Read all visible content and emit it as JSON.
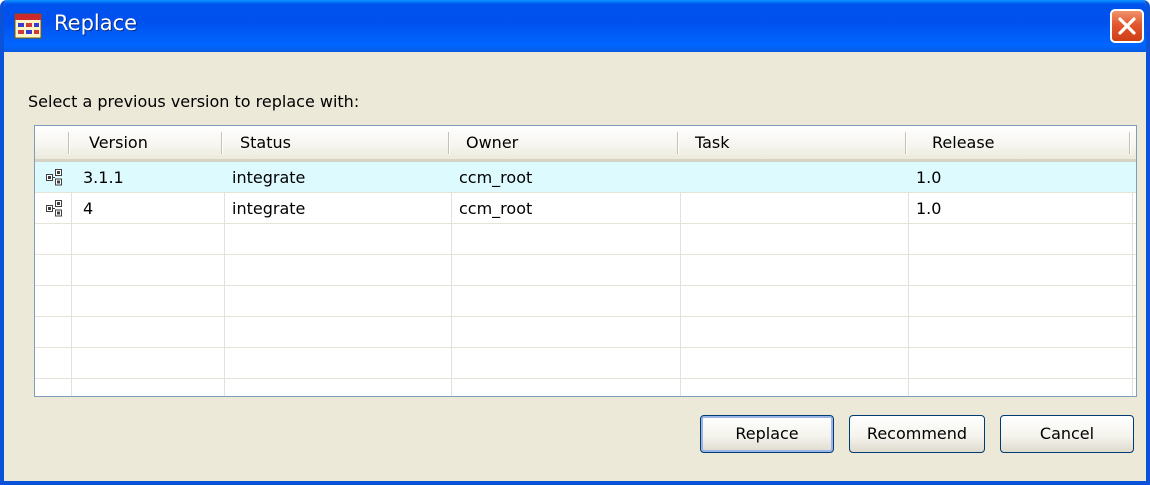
{
  "window": {
    "title": "Replace",
    "icon": "app-icon"
  },
  "close_icon": "close-icon",
  "prompt": "Select a previous version to replace with:",
  "table": {
    "columns": [
      "Version",
      "Status",
      "Owner",
      "Task",
      "Release"
    ],
    "rows": [
      {
        "icon": "object-icon",
        "version": "3.1.1",
        "status": "integrate",
        "owner": "ccm_root",
        "task": "",
        "release": "1.0",
        "selected": true
      },
      {
        "icon": "object-icon",
        "version": "4",
        "status": "integrate",
        "owner": "ccm_root",
        "task": "",
        "release": "1.0",
        "selected": false
      }
    ]
  },
  "buttons": {
    "replace": "Replace",
    "recommend": "Recommend",
    "cancel": "Cancel"
  },
  "colors": {
    "titlebar": "#0050ee",
    "selected_row": "#ddfaff",
    "window_bg": "#ece9d8"
  }
}
